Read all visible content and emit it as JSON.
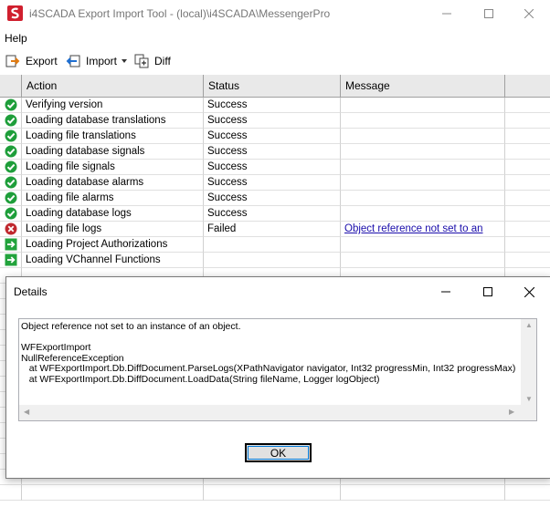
{
  "window": {
    "title": "i4SCADA Export Import Tool - (local)\\i4SCADA\\MessengerPro"
  },
  "menu": {
    "help_label": "Help"
  },
  "toolbar": {
    "export_label": "Export",
    "import_label": "Import",
    "diff_label": "Diff"
  },
  "grid": {
    "columns": [
      "Action",
      "Status",
      "Message"
    ],
    "rows": [
      {
        "icon": "success-check-icon",
        "action": "Verifying version",
        "status": "Success",
        "message": ""
      },
      {
        "icon": "success-check-icon",
        "action": "Loading database translations",
        "status": "Success",
        "message": ""
      },
      {
        "icon": "success-check-icon",
        "action": "Loading file translations",
        "status": "Success",
        "message": ""
      },
      {
        "icon": "success-check-icon",
        "action": "Loading database signals",
        "status": "Success",
        "message": ""
      },
      {
        "icon": "success-check-icon",
        "action": "Loading file signals",
        "status": "Success",
        "message": ""
      },
      {
        "icon": "success-check-icon",
        "action": "Loading database alarms",
        "status": "Success",
        "message": ""
      },
      {
        "icon": "success-check-icon",
        "action": "Loading file alarms",
        "status": "Success",
        "message": ""
      },
      {
        "icon": "success-check-icon",
        "action": "Loading database logs",
        "status": "Success",
        "message": ""
      },
      {
        "icon": "failed-x-icon",
        "action": "Loading file logs",
        "status": "Failed",
        "message": "Object reference not set to an "
      },
      {
        "icon": "in-progress-arrow-icon",
        "action": "Loading Project Authorizations",
        "status": "",
        "message": ""
      },
      {
        "icon": "in-progress-arrow-icon",
        "action": "Loading VChannel Functions",
        "status": "",
        "message": ""
      }
    ]
  },
  "dialog": {
    "title": "Details",
    "text": "Object reference not set to an instance of an object.\n\nWFExportImport\nNullReferenceException\n   at WFExportImport.Db.DiffDocument.ParseLogs(XPathNavigator navigator, Int32 progressMin, Int32 progressMax)\n   at WFExportImport.Db.DiffDocument.LoadData(String fileName, Logger logObject)",
    "ok_label": "OK"
  },
  "colors": {
    "success": "#1e9e3a",
    "failed": "#c0282e",
    "in_progress": "#22a33c",
    "link": "#1a0dab",
    "brand": "#d01f2e"
  }
}
